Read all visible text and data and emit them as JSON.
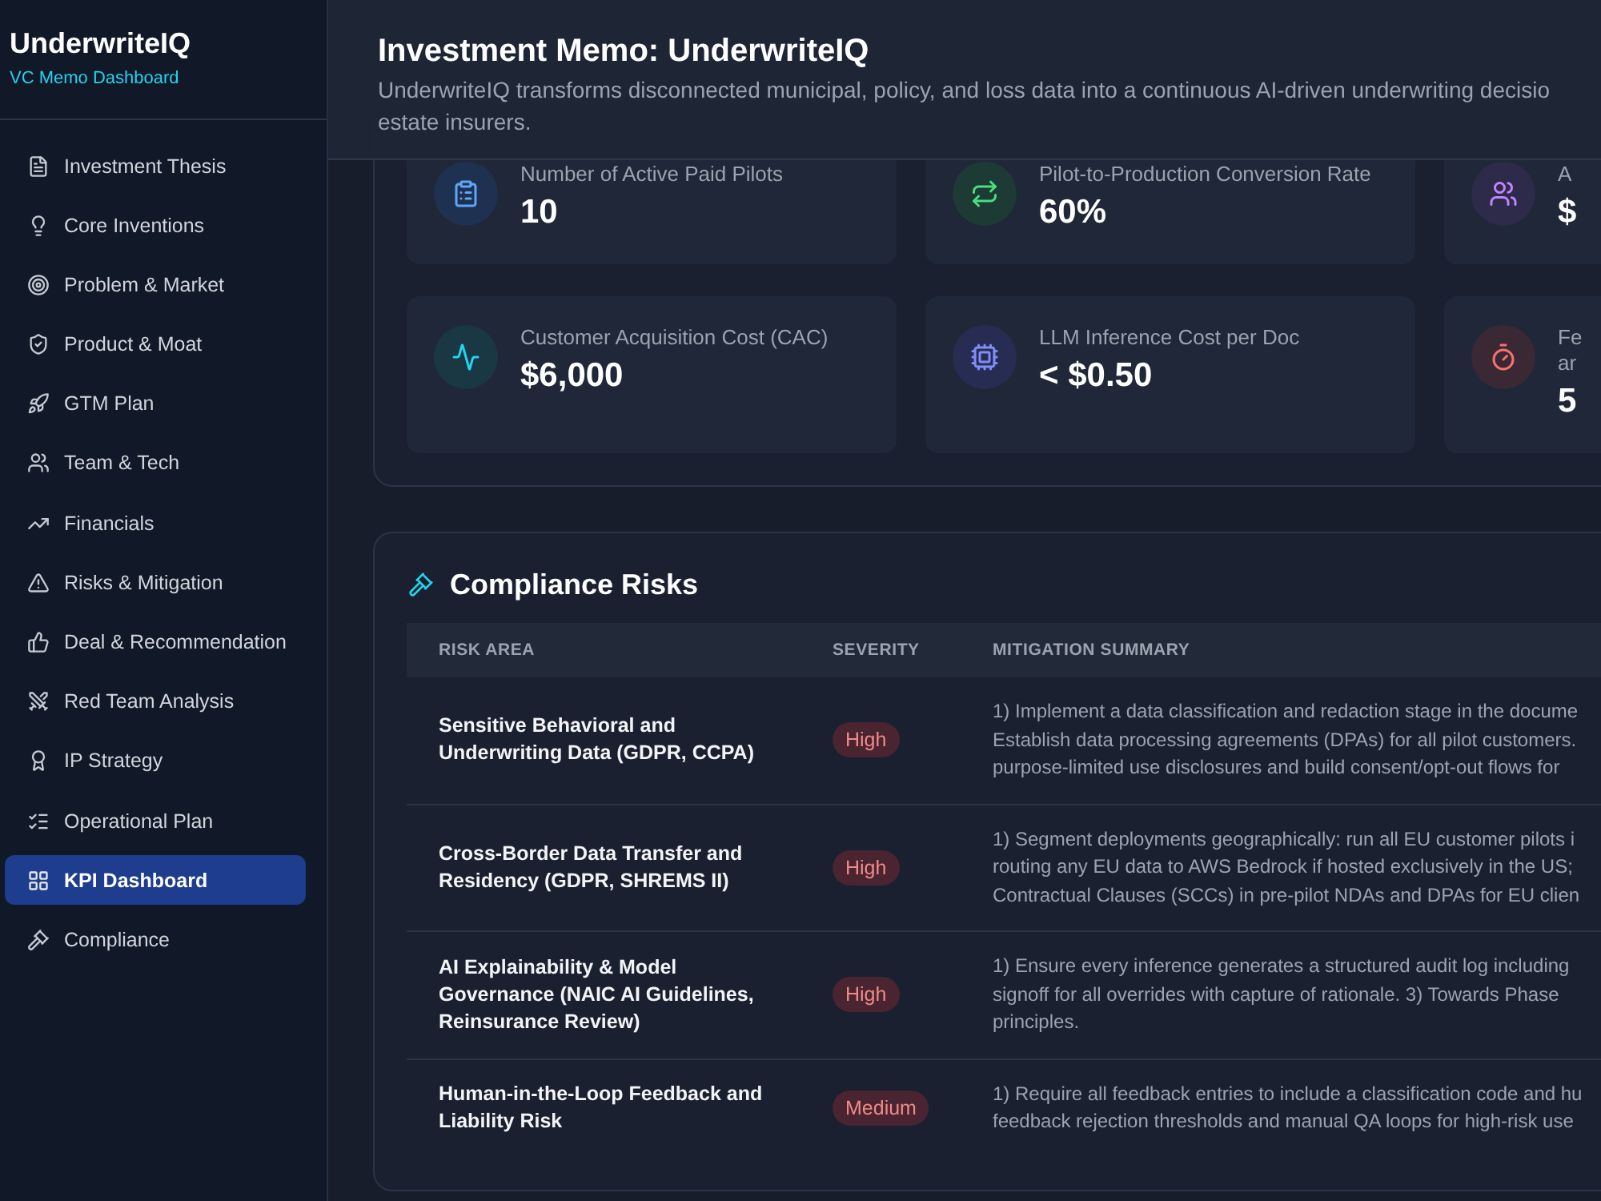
{
  "sidebar": {
    "title": "UnderwriteIQ",
    "subtitle": "VC Memo Dashboard",
    "items": [
      {
        "label": "Investment Thesis",
        "selected": false
      },
      {
        "label": "Core Inventions",
        "selected": false
      },
      {
        "label": "Problem & Market",
        "selected": false
      },
      {
        "label": "Product & Moat",
        "selected": false
      },
      {
        "label": "GTM Plan",
        "selected": false
      },
      {
        "label": "Team & Tech",
        "selected": false
      },
      {
        "label": "Financials",
        "selected": false
      },
      {
        "label": "Risks & Mitigation",
        "selected": false
      },
      {
        "label": "Deal & Recommendation",
        "selected": false
      },
      {
        "label": "Red Team Analysis",
        "selected": false
      },
      {
        "label": "IP Strategy",
        "selected": false
      },
      {
        "label": "Operational Plan",
        "selected": false
      },
      {
        "label": "KPI Dashboard",
        "selected": true
      },
      {
        "label": "Compliance",
        "selected": false
      }
    ]
  },
  "header": {
    "title": "Investment Memo: UnderwriteIQ",
    "description": "UnderwriteIQ transforms disconnected municipal, policy, and loss data into a continuous AI-driven underwriting decisio\nestate insurers."
  },
  "kpi_cards": [
    {
      "label": "Number of Active Paid Pilots",
      "value": "10"
    },
    {
      "label": "Pilot-to-Production Conversion Rate",
      "value": "60%"
    },
    {
      "label": "A",
      "value": "$"
    },
    {
      "label": "Customer Acquisition Cost (CAC)",
      "value": "$6,000"
    },
    {
      "label": "LLM Inference Cost per Doc",
      "value": "< $0.50"
    },
    {
      "label": "Fe\nar",
      "value": "5"
    }
  ],
  "compliance_risks": {
    "title": "Compliance Risks",
    "columns": [
      "RISK AREA",
      "SEVERITY",
      "MITIGATION SUMMARY"
    ],
    "rows": [
      {
        "risk_area": "Sensitive Behavioral and Underwriting Data (GDPR, CCPA)",
        "severity": "High",
        "mitigation": "1) Implement a data classification and redaction stage in the docume\nEstablish data processing agreements (DPAs) for all pilot customers.\npurpose-limited use disclosures and build consent/opt-out flows for"
      },
      {
        "risk_area": "Cross-Border Data Transfer and Residency (GDPR, SHREMS II)",
        "severity": "High",
        "mitigation": "1) Segment deployments geographically: run all EU customer pilots i\nrouting any EU data to AWS Bedrock if hosted exclusively in the US;\nContractual Clauses (SCCs) in pre-pilot NDAs and DPAs for EU clien"
      },
      {
        "risk_area": "AI Explainability & Model Governance (NAIC AI Guidelines, Reinsurance Review)",
        "severity": "High",
        "mitigation": "1) Ensure every inference generates a structured audit log including\nsignoff for all overrides with capture of rationale. 3) Towards Phase\nprinciples."
      },
      {
        "risk_area": "Human-in-the-Loop Feedback and Liability Risk",
        "severity": "Medium",
        "mitigation": "1) Require all feedback entries to include a classification code and hu\nfeedback rejection thresholds and manual QA loops for high-risk use"
      }
    ]
  }
}
